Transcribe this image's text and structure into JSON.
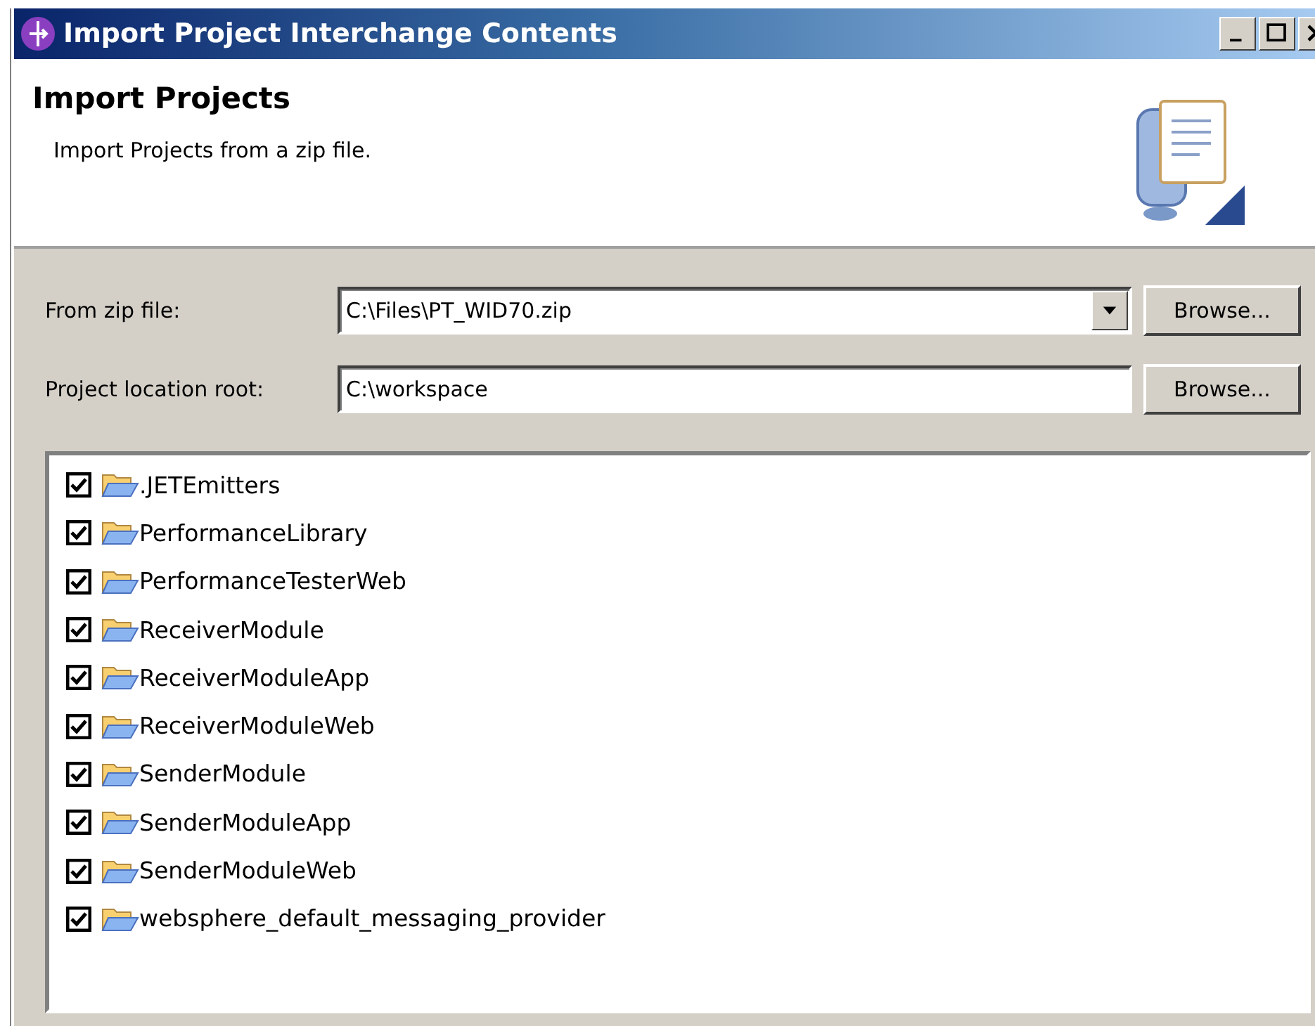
{
  "window": {
    "title": "Import Project Interchange Contents"
  },
  "header": {
    "title": "Import Projects",
    "description": "Import Projects from a zip file."
  },
  "form": [
    {
      "kind": "combo",
      "label": "From zip file:",
      "value": "C:\\Files\\PT_WID70.zip",
      "button": "Browse..."
    },
    {
      "kind": "text",
      "label": "Project location root:",
      "value": "C:\\workspace",
      "button": "Browse..."
    }
  ],
  "projects": [
    {
      "name": ".JETEmitters",
      "checked": true
    },
    {
      "name": "PerformanceLibrary",
      "checked": true
    },
    {
      "name": "PerformanceTesterWeb",
      "checked": true
    },
    {
      "name": "ReceiverModule",
      "checked": true
    },
    {
      "name": "ReceiverModuleApp",
      "checked": true
    },
    {
      "name": "ReceiverModuleWeb",
      "checked": true
    },
    {
      "name": "SenderModule",
      "checked": true
    },
    {
      "name": "SenderModuleApp",
      "checked": true
    },
    {
      "name": "SenderModuleWeb",
      "checked": true
    },
    {
      "name": "websphere_default_messaging_provider",
      "checked": true
    }
  ]
}
